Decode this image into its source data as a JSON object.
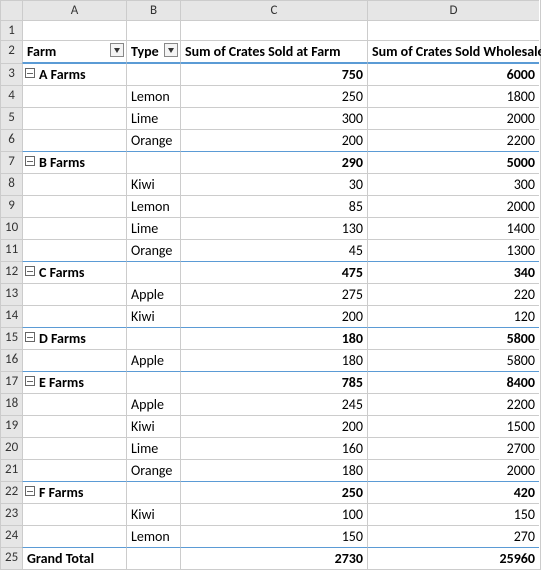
{
  "columns": [
    "A",
    "B",
    "C",
    "D"
  ],
  "row_numbers": [
    "1",
    "2",
    "3",
    "4",
    "5",
    "6",
    "7",
    "8",
    "9",
    "10",
    "11",
    "12",
    "13",
    "14",
    "15",
    "16",
    "17",
    "18",
    "19",
    "20",
    "21",
    "22",
    "23",
    "24",
    "25"
  ],
  "headers": {
    "farm": "Farm",
    "type": "Type",
    "sum_farm": "Sum of Crates Sold at Farm",
    "sum_wholesale": "Sum of Crates Sold Wholesale"
  },
  "groups": [
    {
      "name": "A Farms",
      "sum_farm": "750",
      "sum_wholesale": "6000",
      "rows": [
        {
          "type": "Lemon",
          "farm": "250",
          "wholesale": "1800"
        },
        {
          "type": "Lime",
          "farm": "300",
          "wholesale": "2000"
        },
        {
          "type": "Orange",
          "farm": "200",
          "wholesale": "2200"
        }
      ]
    },
    {
      "name": "B Farms",
      "sum_farm": "290",
      "sum_wholesale": "5000",
      "rows": [
        {
          "type": "Kiwi",
          "farm": "30",
          "wholesale": "300"
        },
        {
          "type": "Lemon",
          "farm": "85",
          "wholesale": "2000"
        },
        {
          "type": "Lime",
          "farm": "130",
          "wholesale": "1400"
        },
        {
          "type": "Orange",
          "farm": "45",
          "wholesale": "1300"
        }
      ]
    },
    {
      "name": "C Farms",
      "sum_farm": "475",
      "sum_wholesale": "340",
      "rows": [
        {
          "type": "Apple",
          "farm": "275",
          "wholesale": "220"
        },
        {
          "type": "Kiwi",
          "farm": "200",
          "wholesale": "120"
        }
      ]
    },
    {
      "name": "D Farms",
      "sum_farm": "180",
      "sum_wholesale": "5800",
      "rows": [
        {
          "type": "Apple",
          "farm": "180",
          "wholesale": "5800"
        }
      ]
    },
    {
      "name": "E Farms",
      "sum_farm": "785",
      "sum_wholesale": "8400",
      "rows": [
        {
          "type": "Apple",
          "farm": "245",
          "wholesale": "2200"
        },
        {
          "type": "Kiwi",
          "farm": "200",
          "wholesale": "1500"
        },
        {
          "type": "Lime",
          "farm": "160",
          "wholesale": "2700"
        },
        {
          "type": "Orange",
          "farm": "180",
          "wholesale": "2000"
        }
      ]
    },
    {
      "name": "F Farms",
      "sum_farm": "250",
      "sum_wholesale": "420",
      "rows": [
        {
          "type": "Kiwi",
          "farm": "100",
          "wholesale": "150"
        },
        {
          "type": "Lemon",
          "farm": "150",
          "wholesale": "270"
        }
      ]
    }
  ],
  "grand_total": {
    "label": "Grand Total",
    "sum_farm": "2730",
    "sum_wholesale": "25960"
  }
}
